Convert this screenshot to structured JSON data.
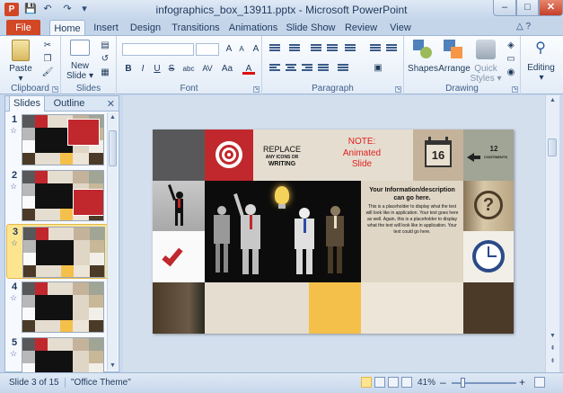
{
  "window": {
    "title": "infographics_box_13911.pptx - Microsoft PowerPoint",
    "app_icon_letter": "P",
    "min": "–",
    "max": "□",
    "close": "✕"
  },
  "quick_access": {
    "save": "💾",
    "undo": "↶",
    "redo": "↷",
    "customize": "▾"
  },
  "tabs": {
    "file": "File",
    "items": [
      "Home",
      "Insert",
      "Design",
      "Transitions",
      "Animations",
      "Slide Show",
      "Review",
      "View"
    ],
    "active": "Home",
    "help_icons": "△ ?"
  },
  "ribbon": {
    "clipboard": {
      "label": "Clipboard",
      "paste": "Paste"
    },
    "slides": {
      "label": "Slides",
      "new_slide": "New",
      "new_slide2": "Slide ▾"
    },
    "font": {
      "label": "Font",
      "bold": "B",
      "italic": "I",
      "underline": "U",
      "strike": "S",
      "shadow": "abc",
      "spacing": "AV",
      "case": "Aa",
      "grow": "A",
      "shrink": "A",
      "clear": "A",
      "color": "A"
    },
    "paragraph": {
      "label": "Paragraph"
    },
    "drawing": {
      "label": "Drawing",
      "shapes": "Shapes",
      "arrange": "Arrange",
      "quick_styles": "Quick",
      "quick_styles2": "Styles ▾"
    },
    "editing": {
      "label": "",
      "editing": "Editing"
    }
  },
  "left_pane": {
    "tabs": [
      "Slides",
      "Outline"
    ],
    "close": "✕",
    "thumbnails": [
      {
        "num": "1",
        "selected": false
      },
      {
        "num": "2",
        "selected": false
      },
      {
        "num": "3",
        "selected": true
      },
      {
        "num": "4",
        "selected": false
      },
      {
        "num": "5",
        "selected": false
      }
    ]
  },
  "slide": {
    "replace_line1": "REPLACE",
    "replace_line2": "ANY ICONS OR",
    "replace_line3": "WRITING",
    "note_title": "NOTE:",
    "note_line2": "Animated",
    "note_line3": "Slide",
    "calendar_number": "16",
    "continents_number": "12",
    "continents_label": "CONTINENTS",
    "info_heading": "Your Information/description can go here.",
    "info_body": "This is a placeholder to display what the text will look like in application. Your text goes here as well. Again, this is a placeholder to display what the text will look like in application. Your text could go here."
  },
  "status": {
    "slide_info": "Slide 3 of 15",
    "theme": "\"Office Theme\"",
    "zoom": "41%",
    "zoom_out": "–",
    "zoom_in": "+"
  },
  "colors": {
    "accent_orange": "#d24726",
    "tile_red": "#c0282d",
    "tile_yellow": "#f5c04a",
    "tile_tan": "#c4b39a",
    "tile_brown": "#4a3a27",
    "tile_gray": "#58585a",
    "tile_sage": "#a0a595"
  }
}
